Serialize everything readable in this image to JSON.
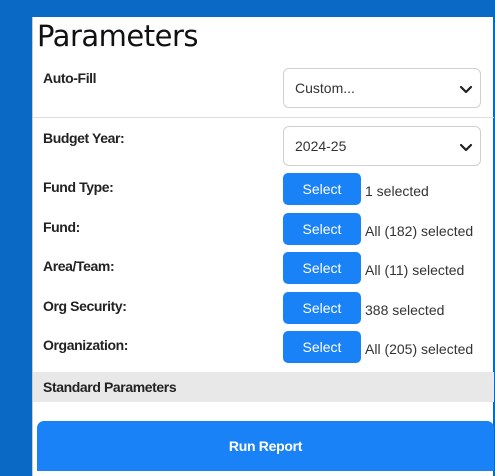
{
  "title": "Parameters",
  "auto_fill": {
    "label": "Auto-Fill",
    "value": "Custom..."
  },
  "budget_year": {
    "label": "Budget Year:",
    "value": "2024-25"
  },
  "select_label": "Select",
  "fields": [
    {
      "label": "Fund Type:",
      "status": "1 selected"
    },
    {
      "label": "Fund:",
      "status": "All (182) selected"
    },
    {
      "label": "Area/Team:",
      "status": "All (11) selected"
    },
    {
      "label": "Org Security:",
      "status": "388 selected"
    },
    {
      "label": "Organization:",
      "status": "All (205) selected"
    }
  ],
  "standard_parameters": "Standard Parameters",
  "run_report": "Run Report",
  "colors": {
    "frame": "#0a69c4",
    "accent": "#1a82f7",
    "section_bar": "#e8e8e8"
  },
  "icons": {
    "dropdown": "chevron-down-icon"
  }
}
